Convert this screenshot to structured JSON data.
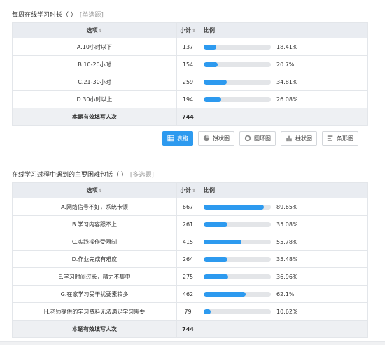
{
  "q1": {
    "title": "每周在线学习时长（ ）",
    "type": "[单选题]",
    "headers": {
      "option": "选项",
      "count": "小计",
      "ratio": "比例"
    },
    "rows": [
      {
        "option": "A.10小时以下",
        "count": "137",
        "pct": "18.41%",
        "fraction": 0.1841
      },
      {
        "option": "B.10-20小时",
        "count": "154",
        "pct": "20.7%",
        "fraction": 0.207
      },
      {
        "option": "C.21-30小时",
        "count": "259",
        "pct": "34.81%",
        "fraction": 0.3481
      },
      {
        "option": "D.30小时以上",
        "count": "194",
        "pct": "26.08%",
        "fraction": 0.2608
      }
    ],
    "total": {
      "label": "本题有效填写人次",
      "count": "744"
    }
  },
  "view_buttons": [
    {
      "label": "表格",
      "icon": "table-icon",
      "active": true
    },
    {
      "label": "饼状图",
      "icon": "pie-chart-icon",
      "active": false
    },
    {
      "label": "圆环图",
      "icon": "donut-chart-icon",
      "active": false
    },
    {
      "label": "柱状图",
      "icon": "bar-chart-icon",
      "active": false
    },
    {
      "label": "条形图",
      "icon": "horizontal-bar-icon",
      "active": false
    }
  ],
  "q2": {
    "title": "在线学习过程中遇到的主要困难包括（ ）",
    "type": "[多选题]",
    "headers": {
      "option": "选项",
      "count": "小计",
      "ratio": "比例"
    },
    "rows": [
      {
        "option": "A.网络信号不好，系统卡顿",
        "count": "667",
        "pct": "89.65%",
        "fraction": 0.8965
      },
      {
        "option": "B.学习内容跟不上",
        "count": "261",
        "pct": "35.08%",
        "fraction": 0.3508
      },
      {
        "option": "C.实践操作受限制",
        "count": "415",
        "pct": "55.78%",
        "fraction": 0.5578
      },
      {
        "option": "D.作业完成有难度",
        "count": "264",
        "pct": "35.48%",
        "fraction": 0.3548
      },
      {
        "option": "E.学习时间过长，精力不集中",
        "count": "275",
        "pct": "36.96%",
        "fraction": 0.3696
      },
      {
        "option": "G.在家学习受干扰要素较多",
        "count": "462",
        "pct": "62.1%",
        "fraction": 0.621
      },
      {
        "option": "H.老师提供的学习资料无法满足学习需要",
        "count": "79",
        "pct": "10.62%",
        "fraction": 0.1062
      }
    ],
    "total": {
      "label": "本题有效填写人次",
      "count": "744"
    }
  },
  "colors": {
    "bar": "#2d9aef",
    "bar_track": "#e3e5e8",
    "header_bg": "#e9ecf1"
  }
}
